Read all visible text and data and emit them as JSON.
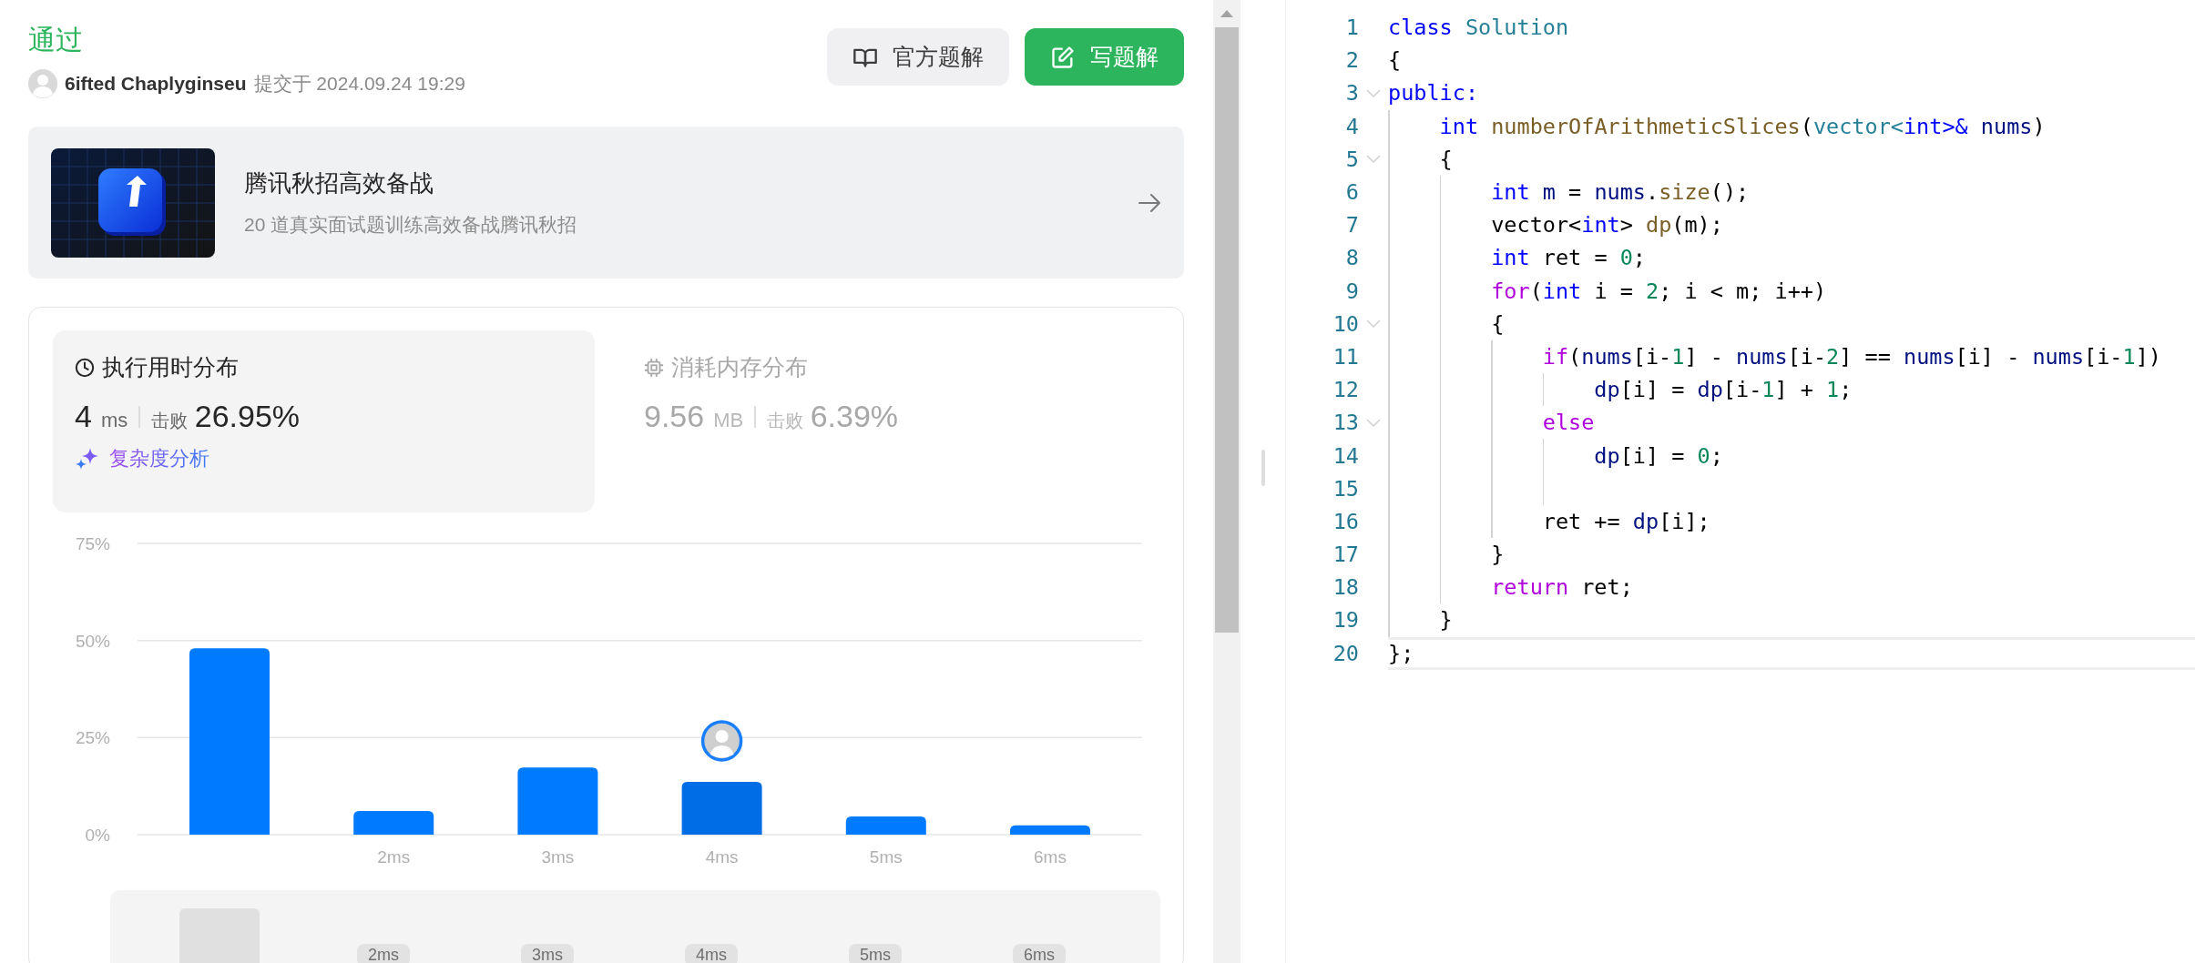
{
  "submission": {
    "status": "通过",
    "user": "6ifted Chaplyginseu",
    "submitted_label": "提交于",
    "submitted_at": "2024.09.24 19:29"
  },
  "actions": [
    {
      "label": "官方题解",
      "kind": "secondary"
    },
    {
      "label": "写题解",
      "kind": "primary"
    }
  ],
  "banner": {
    "title": "腾讯秋招高效备战",
    "subtitle": "20 道真实面试题训练高效备战腾讯秋招"
  },
  "stats": [
    {
      "kind": "time",
      "title": "执行用时分布",
      "selected": true,
      "value": "4",
      "unit": "ms",
      "beat_label": "击败",
      "beat": "26.95%"
    },
    {
      "kind": "memory",
      "title": "消耗内存分布",
      "selected": false,
      "value": "9.56",
      "unit": "MB",
      "beat_label": "击败",
      "beat": "6.39%"
    }
  ],
  "analysis_link": "复杂度分析",
  "chart": {
    "chart_data": {
      "type": "bar",
      "categories": [
        null,
        "2ms",
        "3ms",
        "4ms",
        "5ms",
        "6ms"
      ],
      "values": [
        48,
        6.1,
        17.3,
        13.6,
        4.7,
        2.4
      ],
      "ylim": [
        0,
        75
      ],
      "yticks": [
        {
          "value": 0,
          "label": "0%"
        },
        {
          "value": 25,
          "label": "25%"
        },
        {
          "value": 50,
          "label": "50%"
        },
        {
          "value": 75,
          "label": "75%"
        }
      ]
    },
    "bars": [
      {
        "selected": false
      },
      {
        "selected": false
      },
      {
        "selected": false
      },
      {
        "selected": true
      },
      {
        "selected": false
      },
      {
        "selected": false
      }
    ],
    "navigator_labels": [
      "2ms",
      "3ms",
      "4ms",
      "5ms",
      "6ms"
    ]
  },
  "editor": {
    "lines": [
      {
        "number": "1",
        "foldable": false,
        "current": false,
        "tokens": [
          {
            "kind": "kw",
            "text": "class"
          },
          {
            "kind": "type",
            "text": " Solution"
          }
        ]
      },
      {
        "number": "2",
        "foldable": false,
        "current": false,
        "tokens": [
          {
            "kind": "plain",
            "text": "{"
          }
        ]
      },
      {
        "number": "3",
        "foldable": true,
        "current": false,
        "tokens": [
          {
            "kind": "kw",
            "text": "public:"
          }
        ]
      },
      {
        "number": "4",
        "foldable": false,
        "current": false,
        "tokens": [
          {
            "kind": "kw",
            "text": "    int"
          },
          {
            "kind": "fn",
            "text": " numberOfArithmeticSlices"
          },
          {
            "kind": "plain",
            "text": "("
          },
          {
            "kind": "type",
            "text": "vector<"
          },
          {
            "kind": "kw",
            "text": "int>&"
          },
          {
            "kind": "var",
            "text": " nums"
          },
          {
            "kind": "plain",
            "text": ")"
          }
        ]
      },
      {
        "number": "5",
        "foldable": true,
        "current": false,
        "tokens": [
          {
            "kind": "plain",
            "text": "    {"
          }
        ]
      },
      {
        "number": "6",
        "foldable": false,
        "current": false,
        "tokens": [
          {
            "kind": "kw",
            "text": "        int"
          },
          {
            "kind": "var",
            "text": " m"
          },
          {
            "kind": "plain",
            "text": " = "
          },
          {
            "kind": "var",
            "text": "nums"
          },
          {
            "kind": "plain",
            "text": "."
          },
          {
            "kind": "fn",
            "text": "size"
          },
          {
            "kind": "plain",
            "text": "();"
          }
        ]
      },
      {
        "number": "7",
        "foldable": false,
        "current": false,
        "tokens": [
          {
            "kind": "plain",
            "text": "        vector<"
          },
          {
            "kind": "kw",
            "text": "int"
          },
          {
            "kind": "plain",
            "text": ">"
          },
          {
            "kind": "fn",
            "text": " dp"
          },
          {
            "kind": "plain",
            "text": "(m);"
          }
        ]
      },
      {
        "number": "8",
        "foldable": false,
        "current": false,
        "tokens": [
          {
            "kind": "kw",
            "text": "        int"
          },
          {
            "kind": "plain",
            "text": " ret = "
          },
          {
            "kind": "num",
            "text": "0"
          },
          {
            "kind": "plain",
            "text": ";"
          }
        ]
      },
      {
        "number": "9",
        "foldable": false,
        "current": false,
        "tokens": [
          {
            "kind": "ctrl",
            "text": "        for"
          },
          {
            "kind": "plain",
            "text": "("
          },
          {
            "kind": "kw",
            "text": "int"
          },
          {
            "kind": "plain",
            "text": " i = "
          },
          {
            "kind": "num",
            "text": "2"
          },
          {
            "kind": "plain",
            "text": "; i < m; i++)"
          }
        ]
      },
      {
        "number": "10",
        "foldable": true,
        "current": false,
        "tokens": [
          {
            "kind": "plain",
            "text": "        {"
          }
        ]
      },
      {
        "number": "11",
        "foldable": false,
        "current": false,
        "tokens": [
          {
            "kind": "ctrl",
            "text": "            if"
          },
          {
            "kind": "plain",
            "text": "("
          },
          {
            "kind": "var",
            "text": "nums"
          },
          {
            "kind": "plain",
            "text": "[i-"
          },
          {
            "kind": "num",
            "text": "1"
          },
          {
            "kind": "plain",
            "text": "] - "
          },
          {
            "kind": "var",
            "text": "nums"
          },
          {
            "kind": "plain",
            "text": "[i-"
          },
          {
            "kind": "num",
            "text": "2"
          },
          {
            "kind": "plain",
            "text": "] == "
          },
          {
            "kind": "var",
            "text": "nums"
          },
          {
            "kind": "plain",
            "text": "[i] - "
          },
          {
            "kind": "var",
            "text": "nums"
          },
          {
            "kind": "plain",
            "text": "[i-"
          },
          {
            "kind": "num",
            "text": "1"
          },
          {
            "kind": "plain",
            "text": "])"
          }
        ]
      },
      {
        "number": "12",
        "foldable": false,
        "current": false,
        "tokens": [
          {
            "kind": "var",
            "text": "                dp"
          },
          {
            "kind": "plain",
            "text": "[i] = "
          },
          {
            "kind": "var",
            "text": "dp"
          },
          {
            "kind": "plain",
            "text": "[i-"
          },
          {
            "kind": "num",
            "text": "1"
          },
          {
            "kind": "plain",
            "text": "] + "
          },
          {
            "kind": "num",
            "text": "1"
          },
          {
            "kind": "plain",
            "text": ";"
          }
        ]
      },
      {
        "number": "13",
        "foldable": true,
        "current": false,
        "tokens": [
          {
            "kind": "ctrl",
            "text": "            else"
          }
        ]
      },
      {
        "number": "14",
        "foldable": false,
        "current": false,
        "tokens": [
          {
            "kind": "var",
            "text": "                dp"
          },
          {
            "kind": "plain",
            "text": "[i] = "
          },
          {
            "kind": "num",
            "text": "0"
          },
          {
            "kind": "plain",
            "text": ";"
          }
        ]
      },
      {
        "number": "15",
        "foldable": false,
        "current": false
      },
      {
        "number": "16",
        "foldable": false,
        "current": false,
        "tokens": [
          {
            "kind": "plain",
            "text": "            ret += "
          },
          {
            "kind": "var",
            "text": "dp"
          },
          {
            "kind": "plain",
            "text": "[i];"
          }
        ]
      },
      {
        "number": "17",
        "foldable": false,
        "current": false,
        "tokens": [
          {
            "kind": "plain",
            "text": "        }"
          }
        ]
      },
      {
        "number": "18",
        "foldable": false,
        "current": false,
        "tokens": [
          {
            "kind": "ctrl",
            "text": "        return"
          },
          {
            "kind": "plain",
            "text": " ret;"
          }
        ]
      },
      {
        "number": "19",
        "foldable": false,
        "current": false,
        "tokens": [
          {
            "kind": "plain",
            "text": "    }"
          }
        ]
      },
      {
        "number": "20",
        "foldable": false,
        "current": true,
        "tokens": [
          {
            "kind": "plain",
            "text": "};"
          }
        ]
      }
    ]
  }
}
